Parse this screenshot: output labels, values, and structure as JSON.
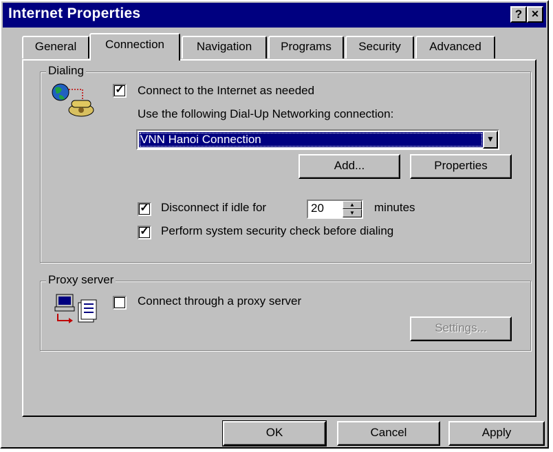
{
  "window": {
    "title": "Internet Properties",
    "help_glyph": "?",
    "close_glyph": "✕"
  },
  "tabs": [
    {
      "label": "General"
    },
    {
      "label": "Connection"
    },
    {
      "label": "Navigation"
    },
    {
      "label": "Programs"
    },
    {
      "label": "Security"
    },
    {
      "label": "Advanced"
    }
  ],
  "active_tab": "Connection",
  "dialing": {
    "legend": "Dialing",
    "connect_as_needed": {
      "label": "Connect to the Internet as needed",
      "checked": true
    },
    "use_connection_label": "Use the following Dial-Up Networking connection:",
    "selected_connection": "VNN Hanoi Connection",
    "add_button": "Add...",
    "properties_button": "Properties",
    "disconnect_idle": {
      "label_before": "Disconnect if idle for",
      "value": "20",
      "label_after": "minutes",
      "checked": true
    },
    "security_check": {
      "label": "Perform system security check before dialing",
      "checked": true
    }
  },
  "proxy": {
    "legend": "Proxy server",
    "connect_via_proxy": {
      "label": "Connect through a proxy server",
      "checked": false
    },
    "settings_button": "Settings..."
  },
  "footer": {
    "ok": "OK",
    "cancel": "Cancel",
    "apply": "Apply"
  },
  "colors": {
    "titlebar": "#000080",
    "face": "#c0c0c0",
    "selection": "#000080"
  },
  "icons": {
    "dialing": "globe-phone-icon",
    "proxy": "computer-network-icon"
  }
}
